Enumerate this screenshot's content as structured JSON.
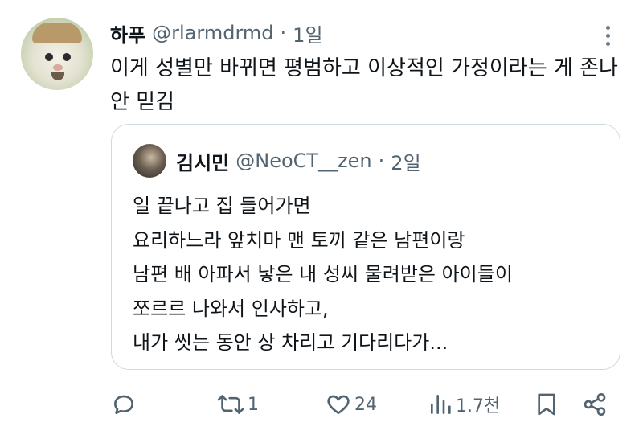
{
  "tweet": {
    "author_name": "하푸",
    "author_handle": "@rlarmdrmd",
    "separator": "·",
    "time": "1일",
    "text": "이게 성별만 바뀌면 평범하고 이상적인 가정이라는 게 존나 안 믿김"
  },
  "quote": {
    "author_name": "김시민",
    "author_handle": "@NeoCT__zen",
    "separator": "·",
    "time": "2일",
    "lines": [
      "일 끝나고 집 들어가면",
      "요리하느라 앞치마 맨 토끼 같은 남편이랑",
      "남편 배 아파서 낳은 내 성씨 물려받은 아이들이",
      "쪼르르 나와서 인사하고,",
      "내가 씻는 동안 상 차리고 기다리다가..."
    ]
  },
  "actions": {
    "reply_icon": "reply-icon",
    "retweet_icon": "retweet-icon",
    "retweet_count": "1",
    "like_icon": "heart-icon",
    "like_count": "24",
    "views_icon": "views-icon",
    "views_count": "1.7천",
    "bookmark_icon": "bookmark-icon",
    "share_icon": "share-icon"
  },
  "colors": {
    "text_primary": "#0f1419",
    "text_secondary": "#536471",
    "border": "#cfd9de"
  }
}
